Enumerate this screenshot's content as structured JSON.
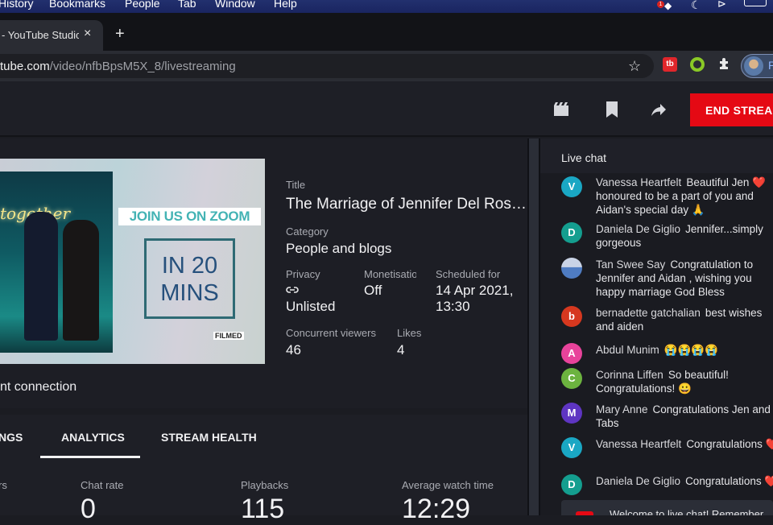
{
  "menubar": {
    "items": [
      "History",
      "Bookmarks",
      "People",
      "Tab",
      "Window",
      "Help"
    ],
    "tray": {
      "notification_badge": "1"
    }
  },
  "browser": {
    "tab_title": "- YouTube Studio",
    "close_glyph": "×",
    "new_tab_glyph": "+",
    "url_host": "tube.com",
    "url_path": "/video/nfbBpsM5X_8/livestreaming",
    "bookmark_glyph": "☆",
    "extensions": [
      {
        "name": "tubebuddy",
        "label": "tb",
        "color": "#e0262b"
      },
      {
        "name": "quip",
        "label": "",
        "color": "#8ac926"
      },
      {
        "name": "extensions-puzzle",
        "label": "✚"
      }
    ],
    "profile_initial": "P"
  },
  "studio_header": {
    "end_stream_label": "END STREAM",
    "end_stream_color": "#e50914",
    "icons": [
      "clapperboard-icon",
      "bookmark-icon",
      "share-icon"
    ]
  },
  "stream_info": {
    "thumbnail": {
      "banner_text": "JOIN US ON ZOOM",
      "box_line1": "IN 20",
      "box_line2": "MINS",
      "watermark": "FILMED",
      "neon_text": "together"
    },
    "title_label": "Title",
    "title_value": "The Marriage of Jennifer Del Rosa...",
    "category_label": "Category",
    "category_value": "People and blogs",
    "privacy_label": "Privacy",
    "privacy_icon": "link-icon",
    "privacy_value": "Unlisted",
    "monetisation_label": "Monetisation",
    "monetisation_value": "Off",
    "scheduled_label": "Scheduled for",
    "scheduled_value_line1": "14 Apr 2021,",
    "scheduled_value_line2": "13:30",
    "viewers_label": "Concurrent viewers",
    "viewers_value": "46",
    "likes_label": "Likes",
    "likes_value": "4",
    "connection_text": "nt connection"
  },
  "tabs": {
    "items": [
      "NGS",
      "ANALYTICS",
      "STREAM HEALTH"
    ],
    "active": "ANALYTICS"
  },
  "analytics": {
    "metrics": [
      {
        "label": "rs",
        "value": ""
      },
      {
        "label": "Chat rate",
        "value": "0"
      },
      {
        "label": "Playbacks",
        "value": "115"
      },
      {
        "label": "Average watch time",
        "value": "12:29"
      }
    ]
  },
  "chat": {
    "header": "Live chat",
    "messages": [
      {
        "initial": "V",
        "color": "#1aa7c4",
        "author": "Vanessa Heartfelt",
        "text": "Beautiful Jen ❤️ honoured to be a part of you and Aidan's special day 🙏"
      },
      {
        "initial": "D",
        "color": "#149e8f",
        "author": "Daniela De Giglio",
        "text": "Jennifer...simply gorgeous"
      },
      {
        "initial": "",
        "color": "#8fa6c8",
        "author": "Tan Swee Say",
        "text": "Congratulation to Jennifer and Aidan , wishing you happy marriage God Bless"
      },
      {
        "initial": "b",
        "color": "#d6381f",
        "author": "bernadette gatchalian",
        "text": "best wishes and aiden"
      },
      {
        "initial": "A",
        "color": "#e8439b",
        "author": "Abdul Munim",
        "text": "😭😭😭😭"
      },
      {
        "initial": "C",
        "color": "#6cb33f",
        "author": "Corinna Liffen",
        "text": "So beautiful! Congratulations! 😀"
      },
      {
        "initial": "M",
        "color": "#5e35c2",
        "author": "Mary Anne",
        "text": "Congratulations Jen and - Tabs"
      },
      {
        "initial": "V",
        "color": "#1aa7c4",
        "author": "Vanessa Heartfelt",
        "text": "Congratulations ❤️"
      },
      {
        "initial": "D",
        "color": "#149e8f",
        "author": "Daniela De Giglio",
        "text": "Congratulations ❤️"
      }
    ],
    "banner_text": "Welcome to live chat! Remember"
  }
}
